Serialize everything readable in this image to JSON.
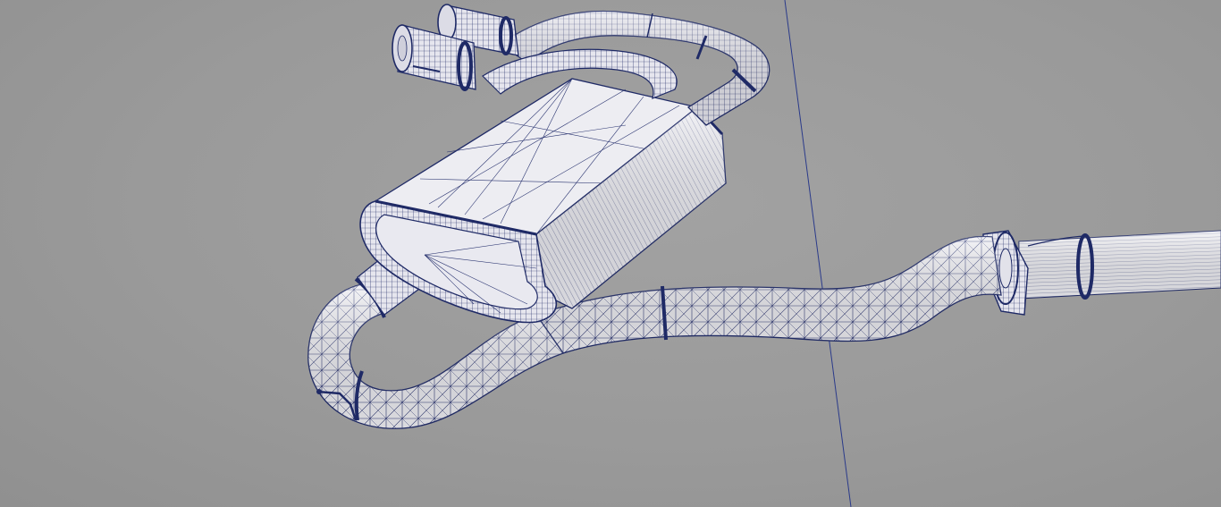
{
  "viewport": {
    "background": "#9c9c9c",
    "mesh_color": "#1f2a66",
    "surface_color": "#f0f0f4",
    "guide_line_color": "#2a3a8a"
  },
  "model": {
    "name_icon": "exhaust-system-wireframe-model",
    "parts": [
      "exhaust-tip-left",
      "exhaust-tip-right",
      "rear-pipe-loop",
      "muffler",
      "inlet-loop-pipe",
      "mid-pipe",
      "flange",
      "front-pipe"
    ]
  }
}
